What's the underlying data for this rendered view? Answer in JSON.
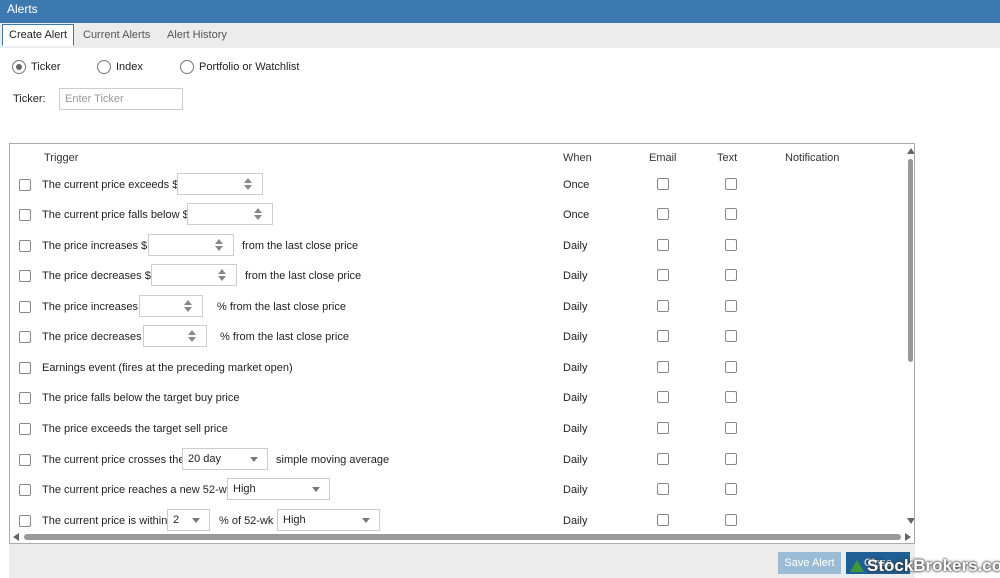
{
  "window": {
    "title": "Alerts"
  },
  "tabs": [
    {
      "label": "Create Alert",
      "active": true
    },
    {
      "label": "Current Alerts",
      "active": false
    },
    {
      "label": "Alert History",
      "active": false
    }
  ],
  "alert_type": {
    "options": [
      {
        "label": "Ticker",
        "selected": true
      },
      {
        "label": "Index",
        "selected": false
      },
      {
        "label": "Portfolio or Watchlist",
        "selected": false
      }
    ]
  },
  "ticker": {
    "label": "Ticker:",
    "placeholder": "Enter Ticker",
    "value": ""
  },
  "table": {
    "headers": {
      "trigger": "Trigger",
      "when": "When",
      "email": "Email",
      "text": "Text",
      "notification": "Notification"
    },
    "rows": [
      {
        "label": "The current price exceeds $",
        "when": "Once"
      },
      {
        "label": "The current price falls below $",
        "when": "Once"
      },
      {
        "label": "The price increases $",
        "suffix": "from the last close price",
        "when": "Daily"
      },
      {
        "label": "The price decreases $",
        "suffix": "from the last close price",
        "when": "Daily"
      },
      {
        "label": "The price increases",
        "suffix": "% from the last close price",
        "when": "Daily"
      },
      {
        "label": "The price decreases",
        "suffix": "% from the last close price",
        "when": "Daily"
      },
      {
        "label": "Earnings event (fires at the preceding market open)",
        "when": "Daily"
      },
      {
        "label": "The price falls below the target buy price",
        "when": "Daily"
      },
      {
        "label": "The price exceeds the target sell price",
        "when": "Daily"
      },
      {
        "label": "The current price crosses the",
        "select": "20 day",
        "suffix": "simple moving average",
        "when": "Daily"
      },
      {
        "label": "The current price reaches a new 52-wk",
        "select": "High",
        "when": "Daily"
      },
      {
        "label": "The current price is within",
        "select": "2",
        "middle": "% of 52-wk",
        "select2": "High",
        "when": "Daily"
      }
    ]
  },
  "footer": {
    "save_label": "Save Alert",
    "close_label": "Close"
  },
  "watermark": {
    "text": "StockBrokers.com"
  }
}
